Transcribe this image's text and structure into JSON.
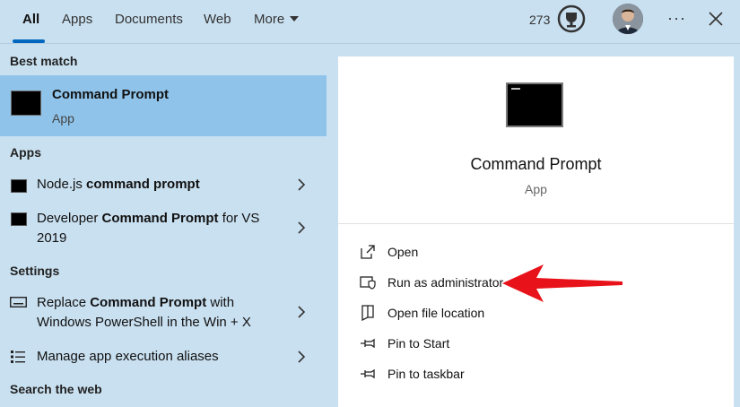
{
  "tabs": [
    "All",
    "Apps",
    "Documents",
    "Web",
    "More"
  ],
  "header": {
    "points": "273"
  },
  "left": {
    "best_match_label": "Best match",
    "best_match": {
      "title": "Command Prompt",
      "subtitle": "App"
    },
    "apps_label": "Apps",
    "apps": [
      {
        "pre": "Node.js ",
        "bold": "command prompt",
        "post": "",
        "line2": ""
      },
      {
        "pre": "Developer ",
        "bold": "Command Prompt",
        "post": " for VS",
        "line2": "2019"
      }
    ],
    "settings_label": "Settings",
    "settings": [
      {
        "pre": "Replace ",
        "bold": "Command Prompt",
        "post": " with",
        "line2": "Windows PowerShell in the Win + X"
      },
      {
        "pre": "Manage app execution aliases",
        "bold": "",
        "post": "",
        "line2": ""
      }
    ],
    "search_web_label": "Search the web"
  },
  "right": {
    "title": "Command Prompt",
    "subtitle": "App",
    "actions": [
      "Open",
      "Run as administrator",
      "Open file location",
      "Pin to Start",
      "Pin to taskbar"
    ]
  },
  "colors": {
    "accent": "#0067c0",
    "highlight": "#8fc3ea",
    "background": "#c9e0f0",
    "annotation_arrow": "#e8131a"
  },
  "icons": [
    "trophy-icon",
    "avatar",
    "more-options-icon",
    "close-icon",
    "open-icon",
    "shield-icon",
    "folder-icon",
    "pin-icon",
    "chevron-right-icon"
  ]
}
